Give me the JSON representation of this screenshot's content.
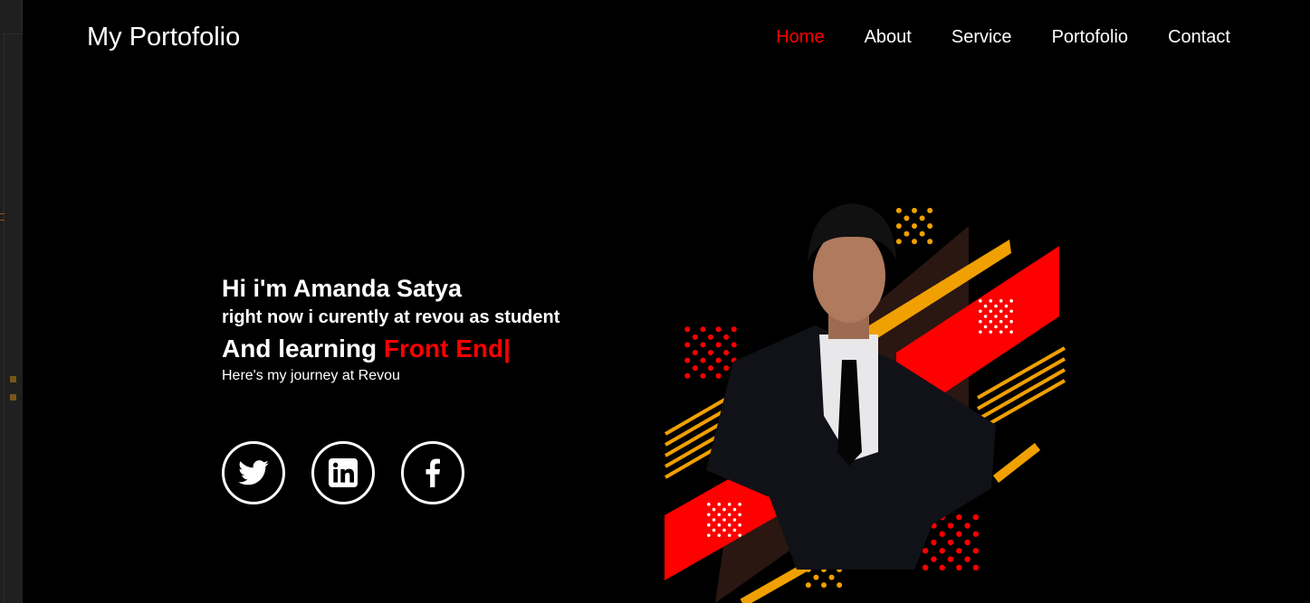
{
  "header": {
    "logo": "My Portofolio",
    "nav": [
      {
        "label": "Home",
        "active": true
      },
      {
        "label": "About"
      },
      {
        "label": "Service"
      },
      {
        "label": "Portofolio"
      },
      {
        "label": "Contact"
      }
    ]
  },
  "hero": {
    "greeting": "Hi i'm Amanda Satya",
    "status": "right now i curently at revou as student",
    "learning_prefix": "And learning",
    "learning_highlight": "Front End|",
    "journey": "Here's my journey at Revou"
  },
  "socials": [
    {
      "icon": "twitter-icon"
    },
    {
      "icon": "linkedin-icon"
    },
    {
      "icon": "facebook-icon"
    }
  ],
  "colors": {
    "accent": "#ff0000",
    "gold": "#f0a000",
    "background": "#000000"
  }
}
